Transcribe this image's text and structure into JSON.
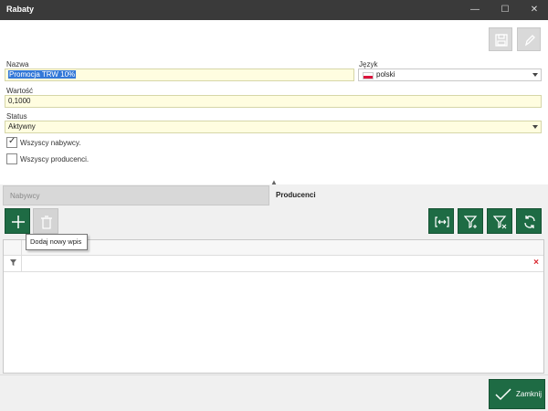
{
  "window": {
    "title": "Rabaty",
    "minimize_glyph": "—",
    "maximize_glyph": "☐",
    "close_glyph": "✕"
  },
  "toolbar": {
    "save_icon": "save-icon",
    "edit_icon": "edit-icon"
  },
  "form": {
    "nazwa": {
      "label": "Nazwa",
      "value": "Promocja TRW 10%"
    },
    "jezyk": {
      "label": "Język",
      "value": "polski",
      "icon": "poland-flag-icon"
    },
    "wartosc": {
      "label": "Wartość",
      "value": "0,1000"
    },
    "status": {
      "label": "Status",
      "value": "Aktywny"
    },
    "wszyscy_nabywcy": {
      "label": "Wszyscy nabywcy.",
      "checked": true
    },
    "wszyscy_producenci": {
      "label": "Wszyscy producenci.",
      "checked": false
    }
  },
  "tabs": [
    {
      "label": "Nabywcy",
      "active": false
    },
    {
      "label": "Producenci",
      "active": true
    }
  ],
  "grid_toolbar": {
    "add_tooltip": "Dodaj nowy wpis",
    "icons": [
      "plus-icon",
      "trash-icon",
      "fit-columns-icon",
      "filter-add-icon",
      "filter-clear-icon",
      "refresh-icon"
    ]
  },
  "grid": {
    "filter_clear_glyph": "×"
  },
  "footer": {
    "close_label": "Zamknij"
  },
  "colors": {
    "accent_green": "#1e6b44",
    "titlebar": "#3a3a3a",
    "field_yellow": "#fffde0",
    "selection_blue": "#3378d8"
  }
}
